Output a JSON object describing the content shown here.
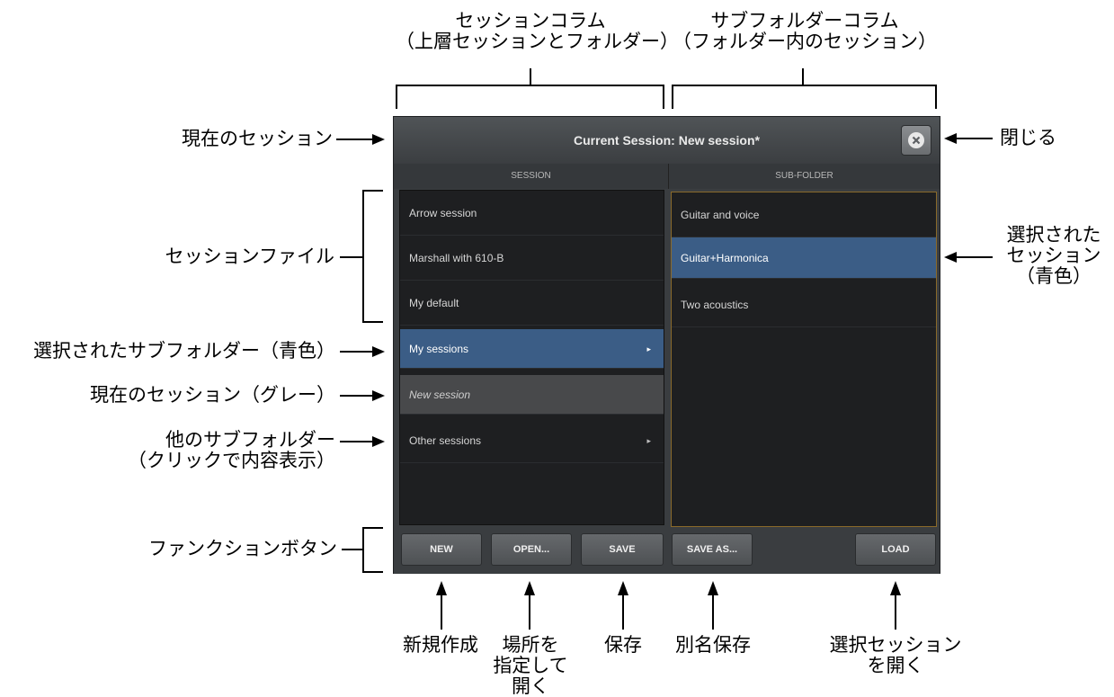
{
  "annotations": {
    "session_column": [
      "セッションコラム",
      "（上層セッションとフォルダー）"
    ],
    "subfolder_column": [
      "サブフォルダーコラム",
      "（フォルダー内のセッション）"
    ],
    "current_session": "現在のセッション",
    "close": "閉じる",
    "session_files": "セッションファイル",
    "selected_session": [
      "選択された",
      "セッション",
      "（青色）"
    ],
    "selected_subfolder": "選択されたサブフォルダー（青色）",
    "current_session_gray": "現在のセッション（グレー）",
    "other_subfolders": [
      "他のサブフォルダー",
      "（クリックで内容表示）"
    ],
    "function_buttons": "ファンクションボタン",
    "new": "新規作成",
    "open": [
      "場所を",
      "指定して",
      "開く"
    ],
    "save": "保存",
    "save_as": "別名保存",
    "load": [
      "選択セッション",
      "を開く"
    ]
  },
  "dialog": {
    "title": "Current Session: New session*",
    "session_header": "SESSION",
    "subfolder_header": "SUB-FOLDER",
    "session_items": [
      {
        "label": "Arrow session",
        "arrow": ""
      },
      {
        "label": "Marshall with 610-B",
        "arrow": ""
      },
      {
        "label": "My default",
        "arrow": ""
      },
      {
        "label": "My sessions",
        "arrow": "▸"
      },
      {
        "label": "New session",
        "arrow": ""
      },
      {
        "label": "Other sessions",
        "arrow": "▸"
      }
    ],
    "subfolder_items": [
      {
        "label": "Guitar and voice"
      },
      {
        "label": "Guitar+Harmonica"
      },
      {
        "label": "Two acoustics"
      }
    ],
    "buttons": {
      "new": "NEW",
      "open": "OPEN...",
      "save": "SAVE",
      "save_as": "SAVE AS...",
      "load": "LOAD"
    }
  },
  "colors": {
    "selected": "#3b5d86",
    "current": "#48494b",
    "list_bg": "#1e1f21"
  },
  "icons": {
    "close": "close-circle-icon",
    "folder_arrow": "chevron-right-icon"
  }
}
